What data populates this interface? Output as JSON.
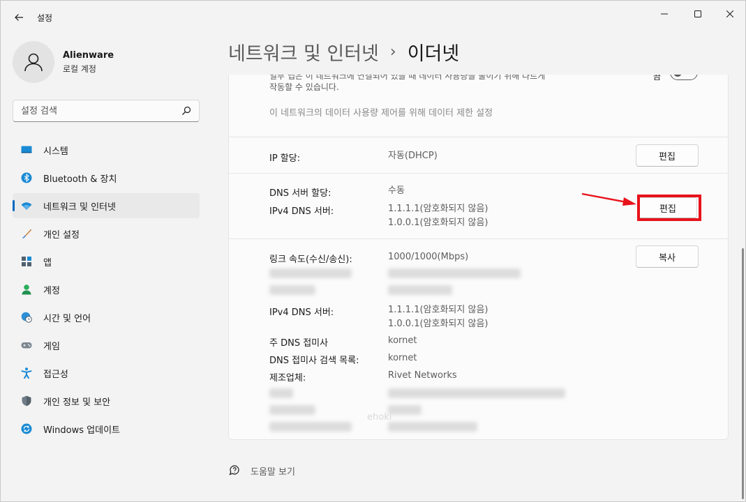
{
  "window": {
    "title": "설정"
  },
  "profile": {
    "name": "Alienware",
    "account_type": "로컬 계정"
  },
  "search": {
    "placeholder": "설정 검색"
  },
  "sidebar": {
    "items": [
      {
        "label": "시스템",
        "icon": "system-icon"
      },
      {
        "label": "Bluetooth & 장치",
        "icon": "bluetooth-icon"
      },
      {
        "label": "네트워크 및 인터넷",
        "icon": "wifi-icon",
        "active": true
      },
      {
        "label": "개인 설정",
        "icon": "brush-icon"
      },
      {
        "label": "앱",
        "icon": "apps-icon"
      },
      {
        "label": "계정",
        "icon": "account-icon"
      },
      {
        "label": "시간 및 언어",
        "icon": "globe-clock-icon"
      },
      {
        "label": "게임",
        "icon": "gamepad-icon"
      },
      {
        "label": "접근성",
        "icon": "accessibility-icon"
      },
      {
        "label": "개인 정보 및 보안",
        "icon": "shield-icon"
      },
      {
        "label": "Windows 업데이트",
        "icon": "update-icon"
      }
    ]
  },
  "breadcrumb": {
    "parent": "네트워크 및 인터넷",
    "separator": "›",
    "current": "이더넷"
  },
  "metered": {
    "description_line1": "일부 앱은 이 네트워크에 연결되어 있을 때 데이터 사용량을 줄이기 위해 다르게",
    "description_line2": "작동할 수 있습니다.",
    "toggle_label": "끔",
    "data_limit_link": "이 네트워크의 데이터 사용량 제어를 위해 데이터 제한 설정"
  },
  "ip_assignment": {
    "label": "IP 할당:",
    "value": "자동(DHCP)",
    "button": "편집"
  },
  "dns_assignment": {
    "label": "DNS 서버 할당:",
    "value": "수동",
    "ipv4_label": "IPv4 DNS 서버:",
    "ipv4_value1": "1.1.1.1(암호화되지 않음)",
    "ipv4_value2": "1.0.0.1(암호화되지 않음)",
    "button": "편집"
  },
  "properties": {
    "link_speed_label": "링크 속도(수신/송신):",
    "link_speed_value": "1000/1000(Mbps)",
    "copy_button": "복사",
    "ipv4_dns_label": "IPv4 DNS 서버:",
    "ipv4_dns_value1": "1.1.1.1(암호화되지 않음)",
    "ipv4_dns_value2": "1.0.0.1(암호화되지 않음)",
    "primary_dns_suffix_label": "주 DNS 접미사",
    "primary_dns_suffix_value": "kornet",
    "dns_suffix_list_label": "DNS 접미사 검색 목록:",
    "dns_suffix_list_value": "kornet",
    "manufacturer_label": "제조업체:",
    "manufacturer_value": "Rivet Networks"
  },
  "help": {
    "label": "도움말 보기"
  },
  "colors": {
    "accent": "#0067c0",
    "highlight": "#e8121b",
    "background": "#f3f3f3",
    "card": "#fbfbfb"
  }
}
